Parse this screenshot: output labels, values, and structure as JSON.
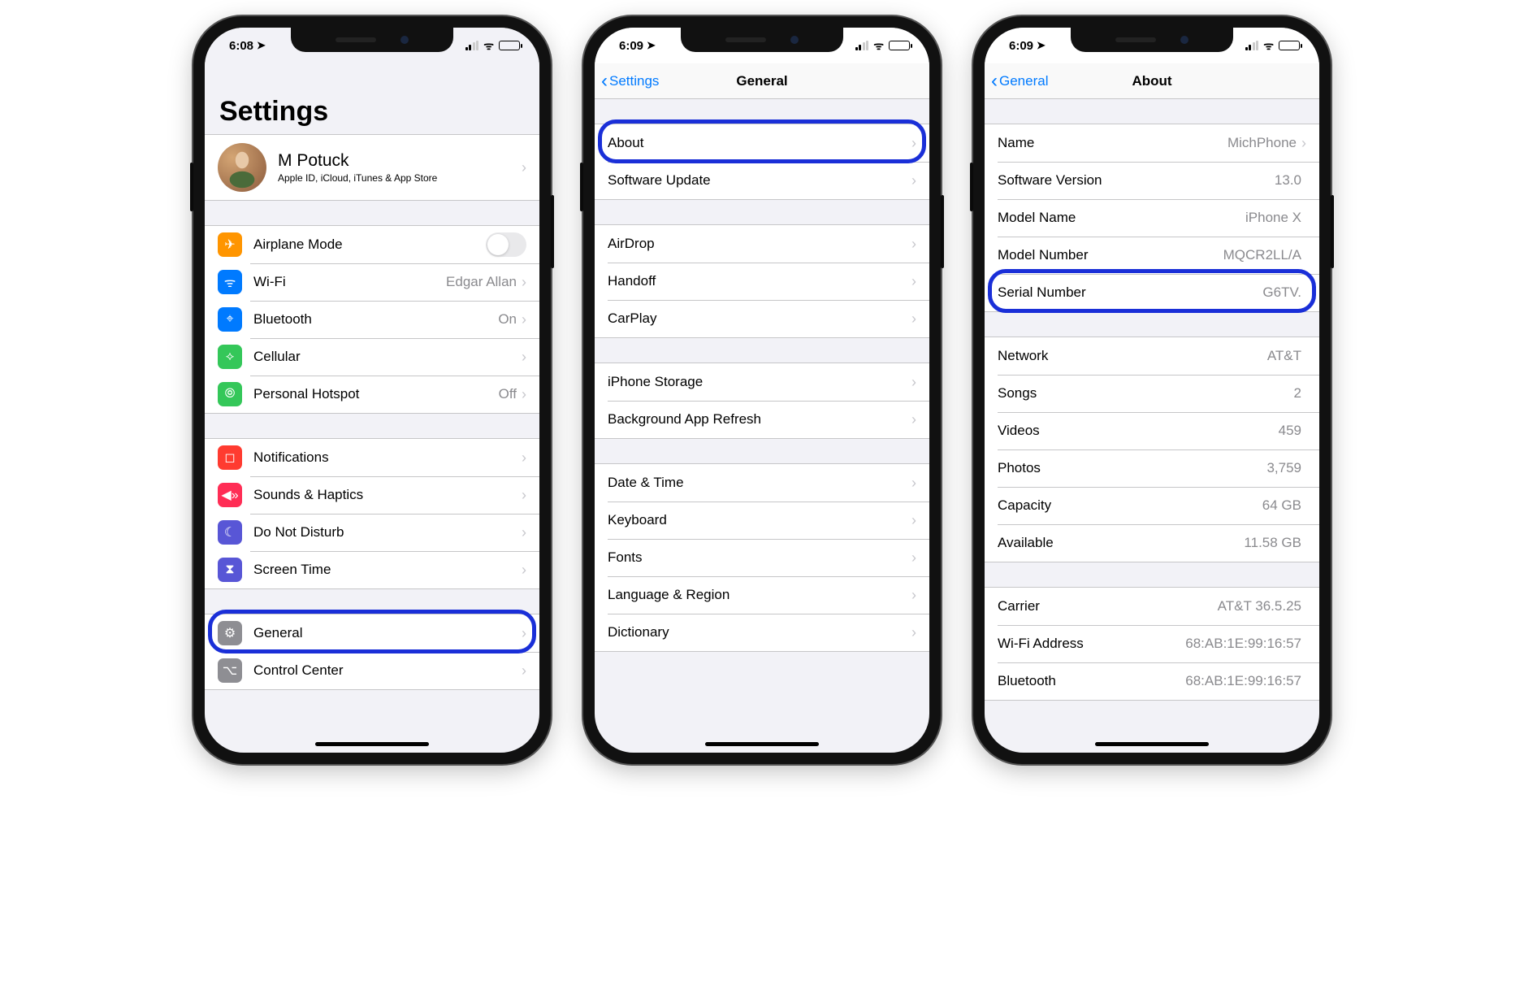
{
  "phone1": {
    "time": "6:08",
    "title": "Settings",
    "profile": {
      "name": "M Potuck",
      "sub": "Apple ID, iCloud, iTunes & App Store"
    },
    "group_net": [
      {
        "icon": "airplane",
        "color": "ic-orange",
        "label": "Airplane Mode",
        "type": "switch"
      },
      {
        "icon": "wifi",
        "color": "ic-blue",
        "label": "Wi-Fi",
        "value": "Edgar Allan"
      },
      {
        "icon": "bt",
        "color": "ic-bt",
        "label": "Bluetooth",
        "value": "On"
      },
      {
        "icon": "cell",
        "color": "ic-green",
        "label": "Cellular",
        "value": ""
      },
      {
        "icon": "hotspot",
        "color": "ic-green2",
        "label": "Personal Hotspot",
        "value": "Off"
      }
    ],
    "group_notif": [
      {
        "icon": "notif",
        "color": "ic-red",
        "label": "Notifications"
      },
      {
        "icon": "sound",
        "color": "ic-red2",
        "label": "Sounds & Haptics"
      },
      {
        "icon": "dnd",
        "color": "ic-purple",
        "label": "Do Not Disturb"
      },
      {
        "icon": "screentime",
        "color": "ic-purple2",
        "label": "Screen Time"
      }
    ],
    "group_gen": [
      {
        "icon": "gear",
        "color": "ic-gray",
        "label": "General"
      },
      {
        "icon": "cc",
        "color": "ic-gray2",
        "label": "Control Center"
      }
    ]
  },
  "phone2": {
    "time": "6:09",
    "back": "Settings",
    "title": "General",
    "g1": [
      "About",
      "Software Update"
    ],
    "g2": [
      "AirDrop",
      "Handoff",
      "CarPlay"
    ],
    "g3": [
      "iPhone Storage",
      "Background App Refresh"
    ],
    "g4": [
      "Date & Time",
      "Keyboard",
      "Fonts",
      "Language & Region",
      "Dictionary"
    ]
  },
  "phone3": {
    "time": "6:09",
    "back": "General",
    "title": "About",
    "g1": [
      {
        "label": "Name",
        "value": "MichPhone",
        "chev": true
      },
      {
        "label": "Software Version",
        "value": "13.0"
      },
      {
        "label": "Model Name",
        "value": "iPhone X"
      },
      {
        "label": "Model Number",
        "value": "MQCR2LL/A"
      },
      {
        "label": "Serial Number",
        "value": "G6TV."
      }
    ],
    "g2": [
      {
        "label": "Network",
        "value": "AT&T"
      },
      {
        "label": "Songs",
        "value": "2"
      },
      {
        "label": "Videos",
        "value": "459"
      },
      {
        "label": "Photos",
        "value": "3,759"
      },
      {
        "label": "Capacity",
        "value": "64 GB"
      },
      {
        "label": "Available",
        "value": "11.58 GB"
      }
    ],
    "g3": [
      {
        "label": "Carrier",
        "value": "AT&T 36.5.25"
      },
      {
        "label": "Wi-Fi Address",
        "value": "68:AB:1E:99:16:57"
      },
      {
        "label": "Bluetooth",
        "value": "68:AB:1E:99:16:57"
      }
    ]
  },
  "icons": {
    "airplane": "✈︎",
    "wifi": "ᯤ",
    "bt": "⌖",
    "cell": "⟡",
    "hotspot": "⦾",
    "notif": "◻︎",
    "sound": "◀︎»",
    "dnd": "☾",
    "screentime": "⧗",
    "gear": "⚙︎",
    "cc": "⌥"
  }
}
